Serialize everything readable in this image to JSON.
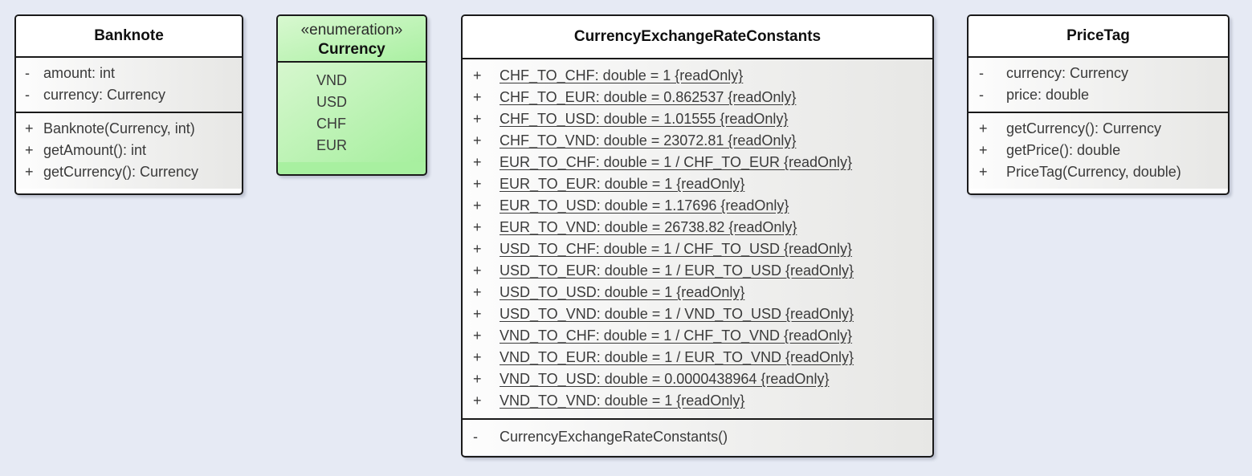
{
  "diagram": {
    "type": "uml-class-diagram",
    "background_color": "#e6eaf4",
    "classes": [
      {
        "id": "banknote",
        "name": "Banknote",
        "stereotype": "",
        "fill_color": "#ffffff",
        "attributes": [
          {
            "visibility": "-",
            "text": "amount: int",
            "static": false
          },
          {
            "visibility": "-",
            "text": "currency: Currency",
            "static": false
          }
        ],
        "operations": [
          {
            "visibility": "+",
            "text": "Banknote(Currency, int)",
            "static": false
          },
          {
            "visibility": "+",
            "text": "getAmount(): int",
            "static": false
          },
          {
            "visibility": "+",
            "text": "getCurrency(): Currency",
            "static": false
          }
        ]
      },
      {
        "id": "currency-enum",
        "name": "Currency",
        "stereotype": "«enumeration»",
        "fill_color": "#a8f0a0",
        "literals": [
          {
            "visibility": "",
            "text": "VND"
          },
          {
            "visibility": "",
            "text": "USD"
          },
          {
            "visibility": "",
            "text": "CHF"
          },
          {
            "visibility": "",
            "text": "EUR"
          }
        ]
      },
      {
        "id": "rate-constants",
        "name": "CurrencyExchangeRateConstants",
        "stereotype": "",
        "fill_color": "#f0f0ee",
        "attributes": [
          {
            "visibility": "+",
            "text": "CHF_TO_CHF: double = 1 {readOnly}",
            "static": true
          },
          {
            "visibility": "+",
            "text": "CHF_TO_EUR: double = 0.862537 {readOnly}",
            "static": true
          },
          {
            "visibility": "+",
            "text": "CHF_TO_USD: double = 1.01555 {readOnly}",
            "static": true
          },
          {
            "visibility": "+",
            "text": "CHF_TO_VND: double = 23072.81 {readOnly}",
            "static": true
          },
          {
            "visibility": "+",
            "text": "EUR_TO_CHF: double = 1 / CHF_TO_EUR {readOnly}",
            "static": true
          },
          {
            "visibility": "+",
            "text": "EUR_TO_EUR: double = 1 {readOnly}",
            "static": true
          },
          {
            "visibility": "+",
            "text": "EUR_TO_USD: double = 1.17696 {readOnly}",
            "static": true
          },
          {
            "visibility": "+",
            "text": "EUR_TO_VND: double = 26738.82 {readOnly}",
            "static": true
          },
          {
            "visibility": "+",
            "text": "USD_TO_CHF: double = 1 / CHF_TO_USD {readOnly}",
            "static": true
          },
          {
            "visibility": "+",
            "text": "USD_TO_EUR: double = 1 / EUR_TO_USD {readOnly}",
            "static": true
          },
          {
            "visibility": "+",
            "text": "USD_TO_USD: double = 1 {readOnly}",
            "static": true
          },
          {
            "visibility": "+",
            "text": "USD_TO_VND: double = 1 / VND_TO_USD {readOnly}",
            "static": true
          },
          {
            "visibility": "+",
            "text": "VND_TO_CHF: double = 1 / CHF_TO_VND {readOnly}",
            "static": true
          },
          {
            "visibility": "+",
            "text": "VND_TO_EUR: double = 1 / EUR_TO_VND {readOnly}",
            "static": true
          },
          {
            "visibility": "+",
            "text": "VND_TO_USD: double = 0.0000438964 {readOnly}",
            "static": true
          },
          {
            "visibility": "+",
            "text": "VND_TO_VND: double = 1 {readOnly}",
            "static": true
          }
        ],
        "operations": [
          {
            "visibility": "-",
            "text": "CurrencyExchangeRateConstants()",
            "static": false
          }
        ]
      },
      {
        "id": "price-tag",
        "name": "PriceTag",
        "stereotype": "",
        "fill_color": "#ffffff",
        "attributes": [
          {
            "visibility": "-",
            "text": "currency: Currency",
            "static": false
          },
          {
            "visibility": "-",
            "text": "price: double",
            "static": false
          }
        ],
        "operations": [
          {
            "visibility": "+",
            "text": "getCurrency(): Currency",
            "static": false
          },
          {
            "visibility": "+",
            "text": "getPrice(): double",
            "static": false
          },
          {
            "visibility": "+",
            "text": "PriceTag(Currency, double)",
            "static": false
          }
        ]
      }
    ]
  }
}
